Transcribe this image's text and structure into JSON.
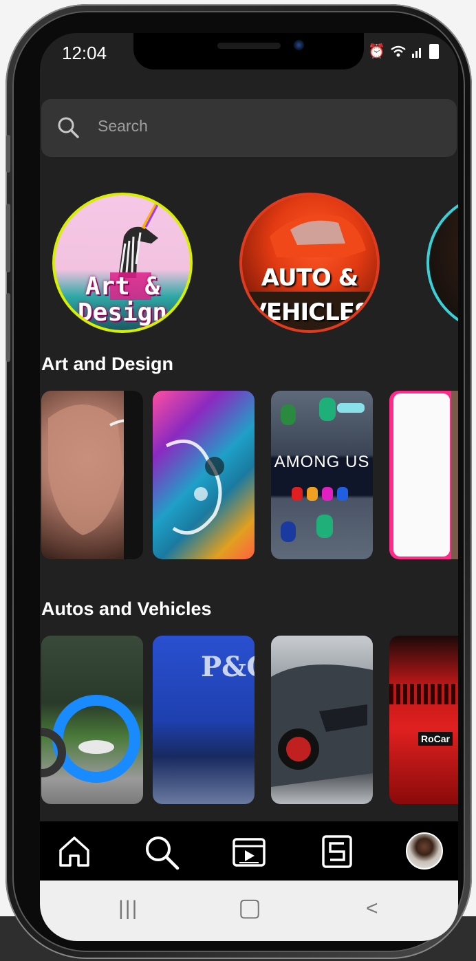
{
  "status_bar": {
    "time": "12:04",
    "icons": [
      "alarm-icon",
      "wifi-icon",
      "signal-icon",
      "battery-icon"
    ]
  },
  "search": {
    "placeholder": "Search"
  },
  "categories": [
    {
      "label_line1": "Art &",
      "label_line2": "Design",
      "ring_color": "#d8f000"
    },
    {
      "label_line1": "AUTO &",
      "label_line2": "VEHICLES",
      "ring_color": "#e03a1f"
    },
    {
      "label_line1": "",
      "label_line2": "",
      "ring_color": "#3ad0d8"
    }
  ],
  "sections": [
    {
      "title": "Art and Design",
      "thumb_text": [
        "",
        "",
        "AMONG US",
        ""
      ]
    },
    {
      "title": "Autos and Vehicles",
      "thumb_text": [
        "",
        "P&O",
        "",
        "RoCar"
      ]
    }
  ],
  "bottom_nav": [
    "home-icon",
    "search-icon",
    "reels-icon",
    "shorts-icon",
    "profile-avatar"
  ],
  "system_nav": [
    "|||",
    "▢",
    "<"
  ]
}
